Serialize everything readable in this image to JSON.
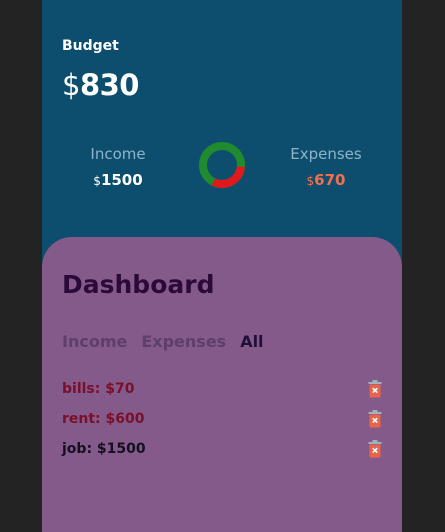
{
  "budget": {
    "label": "Budget",
    "currency": "$",
    "amount": "830"
  },
  "income": {
    "label": "Income",
    "currency": "$",
    "amount": "1500"
  },
  "expenses": {
    "label": "Expenses",
    "currency": "$",
    "amount": "670"
  },
  "donut": {
    "income_color": "#1f8a2e",
    "expense_color": "#e01a1a",
    "expense_fraction": 0.31
  },
  "dashboard": {
    "title": "Dashboard",
    "tabs": [
      {
        "label": "Income",
        "active": false
      },
      {
        "label": "Expenses",
        "active": false
      },
      {
        "label": "All",
        "active": true
      }
    ],
    "items": [
      {
        "text": "bills: $70",
        "type": "expense",
        "icon": "trash-icon"
      },
      {
        "text": "rent: $600",
        "type": "expense",
        "icon": "trash-icon"
      },
      {
        "text": "job: $1500",
        "type": "income",
        "icon": "trash-icon"
      }
    ]
  },
  "colors": {
    "background": "#232323",
    "header": "#0d4e6e",
    "panel": "#845a8a",
    "expense_text": "#7a0f2a",
    "expense_amount": "#f0704e",
    "delete_icon": "#e8654a"
  }
}
